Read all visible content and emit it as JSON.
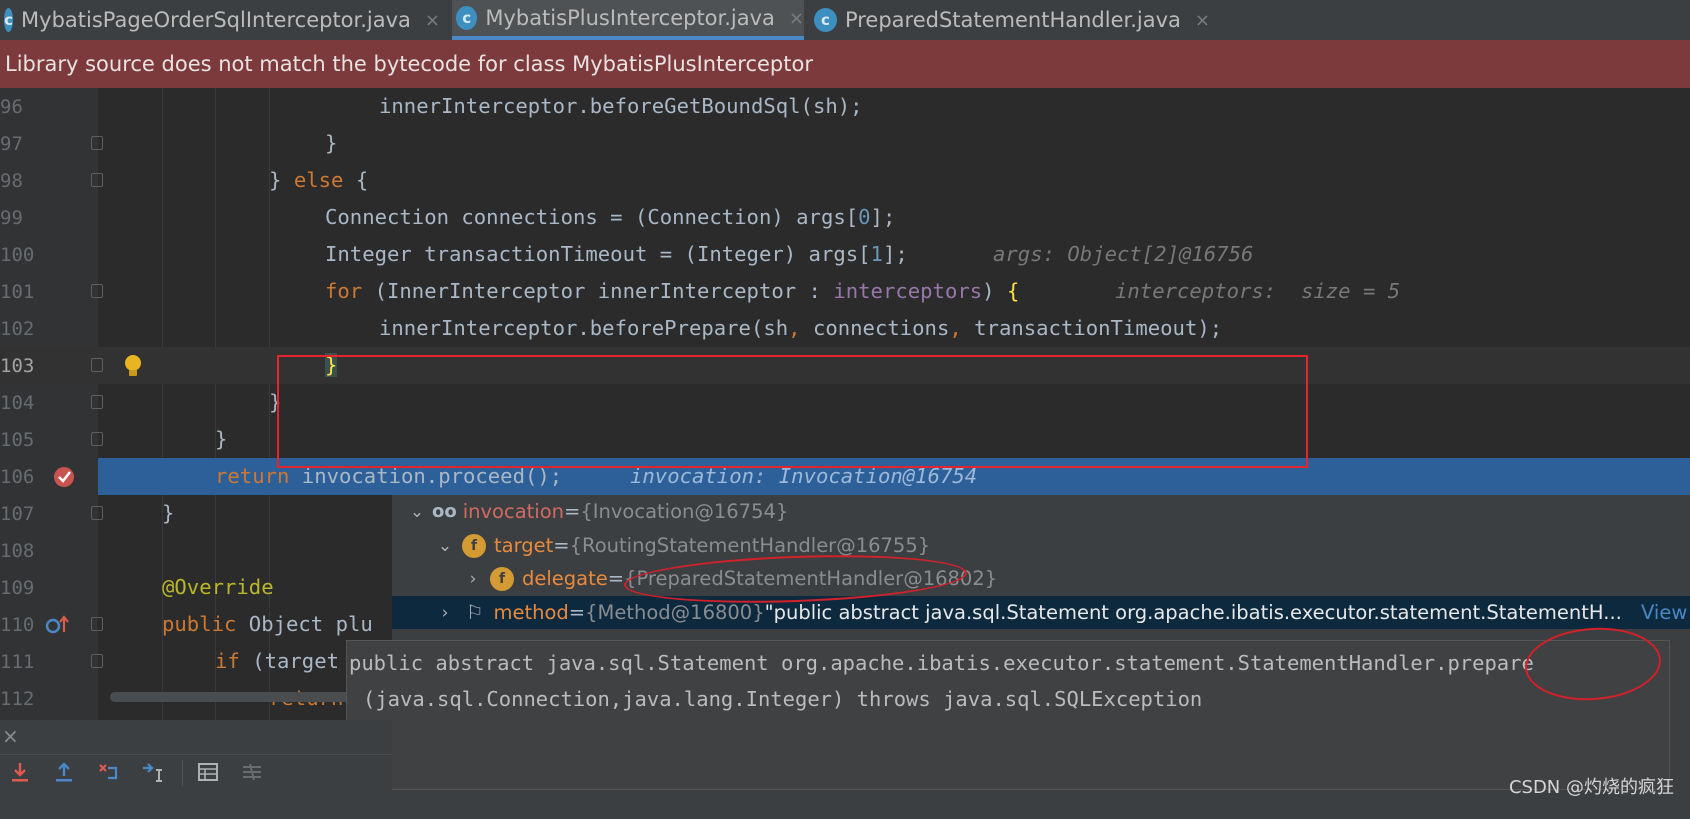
{
  "tabs": [
    {
      "label": "MybatisPageOrderSqlInterceptor.java",
      "active": false
    },
    {
      "label": "MybatisPlusInterceptor.java",
      "active": true
    },
    {
      "label": "PreparedStatementHandler.java",
      "active": false
    }
  ],
  "tab_close_glyph": "×",
  "tab_icon_glyph": "c",
  "banner": "Library source does not match the bytecode for class MybatisPlusInterceptor",
  "lines": {
    "n96": "96",
    "n97": "97",
    "n98": "98",
    "n99": "99",
    "n100": "100",
    "n101": "101",
    "n102": "102",
    "n103": "103",
    "n104": "104",
    "n105": "105",
    "n106": "106",
    "n107": "107",
    "n108": "108",
    "n109": "109",
    "n110": "110",
    "n111": "111",
    "n112": "112"
  },
  "code": {
    "l96": "innerInterceptor.beforeGetBoundSql(sh);",
    "l97": "}",
    "l98_a": "} ",
    "l98_kw": "else",
    "l98_b": " {",
    "l99_a": "Connection connections = (Connection) args[",
    "l99_n": "0",
    "l99_b": "];",
    "l100_a": "Integer transactionTimeout = (Integer) args[",
    "l100_n": "1",
    "l100_b": "];",
    "l100_hint": "args: Object[2]@16756",
    "l101_kw": "for",
    "l101_a": " (InnerInterceptor innerInterceptor : ",
    "l101_field": "interceptors",
    "l101_b": ") ",
    "l101_brace": "{",
    "l101_hint": "interceptors:  size = 5",
    "l102_a": "innerInterceptor.beforePrepare(sh",
    "l102_c1": ",",
    "l102_b": " connections",
    "l102_c2": ",",
    "l102_c": " transactionTimeout);",
    "l103_brace": "}",
    "l104": "}",
    "l105": "}",
    "l106_kw": "return",
    "l106_a": " invocation.proceed();",
    "l106_hint": "invocation: Invocation@16754",
    "l107": "}",
    "l109": "@Override",
    "l110_kw": "public",
    "l110_a": " Object plu",
    "l111_kw": "if",
    "l111_a": " (target",
    "l112_kw": "return"
  },
  "debug_tree": [
    {
      "name": "invocation",
      "eq": " = ",
      "value": "{Invocation@16754}",
      "badge": "oo",
      "chevron": "⌄"
    },
    {
      "name": "target",
      "eq": " = ",
      "value": "{RoutingStatementHandler@16755}",
      "badge": "f",
      "chevron": "⌄"
    },
    {
      "name": "delegate",
      "eq": " = ",
      "value": "{PreparedStatementHandler@16802}",
      "badge": "f",
      "chevron": "›"
    },
    {
      "name": "method",
      "eq": " = ",
      "value": "{Method@16800}",
      "string": " \"public abstract java.sql.Statement org.apache.ibatis.executor.statement.StatementH...",
      "link": "View",
      "badge": "⚐",
      "chevron": "›"
    }
  ],
  "tooltip": {
    "line1": "public abstract java.sql.Statement org.apache.ibatis.executor.statement.StatementHandler.prepare",
    "line2": "(java.sql.Connection,java.lang.Integer) throws java.sql.SQLException"
  },
  "left_pane": {
    "close": "×"
  },
  "watermark": "CSDN @灼烧的疯狂",
  "colors": {
    "exec_line": "#2d6099",
    "banner": "#7c3a3c",
    "annotation_red": "#e3262d"
  }
}
